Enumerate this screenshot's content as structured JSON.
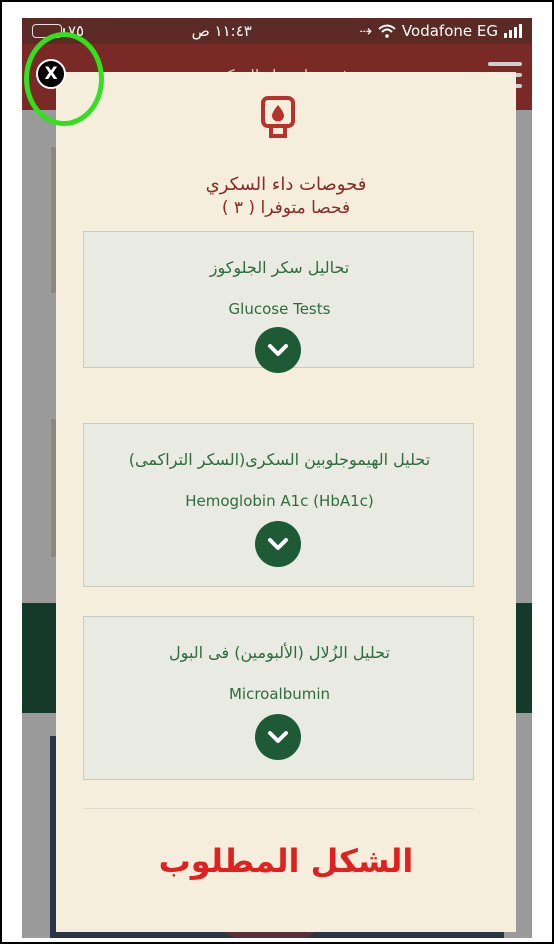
{
  "status_bar": {
    "left_text": "٧٥",
    "time": "١١:٤٣ ص",
    "carrier": "Vodafone EG"
  },
  "background": {
    "app_title": "فحوصات داء السكري"
  },
  "close_button": {
    "label": "X"
  },
  "modal": {
    "icon": "blood-glucose-meter-icon",
    "title": "فحوصات داء السكري",
    "subtitle": "( ٣ ) فحصا متوفرا",
    "tests": [
      {
        "name_ar": "تحاليل سكر الجلوكوز",
        "name_en": "Glucose Tests",
        "expand_icon": "chevron-down-icon"
      },
      {
        "name_ar": "تحليل الهيموجلوبين السكرى(السكر التراكمى)",
        "name_en": "Hemoglobin A1c (HbA1c)",
        "expand_icon": "chevron-down-icon"
      },
      {
        "name_ar": "تحليل الزُلال (الألبومين) فى البول",
        "name_en": "Microalbumin",
        "expand_icon": "chevron-down-icon"
      }
    ]
  },
  "annotation": {
    "required_form_label": "الشكل المطلوب"
  },
  "colors": {
    "modal_bg": "#f6eedc",
    "accent_red": "#8b2a26",
    "green": "#1f5a36",
    "highlight_ring": "#33e01e",
    "annotation_red": "#e02121"
  }
}
